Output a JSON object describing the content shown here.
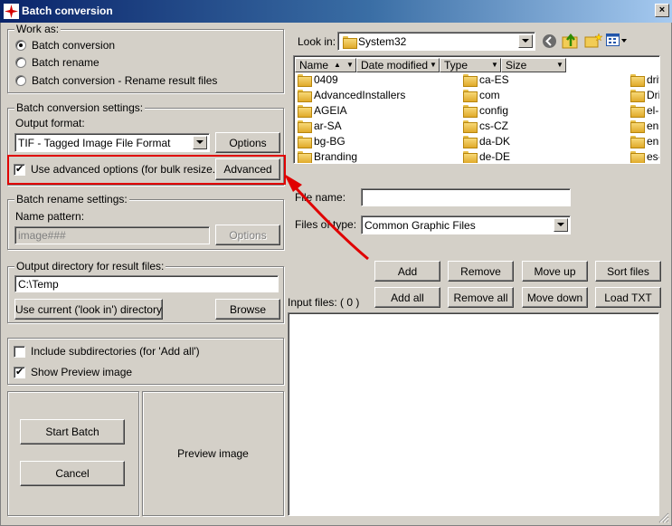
{
  "window": {
    "title": "Batch conversion",
    "close_glyph": "×"
  },
  "work_as": {
    "title": "Work as:",
    "options": [
      "Batch conversion",
      "Batch rename",
      "Batch conversion - Rename result files"
    ],
    "selected": 0
  },
  "conversion": {
    "title": "Batch conversion settings:",
    "output_format_label": "Output format:",
    "output_format_value": "TIF - Tagged Image File Format",
    "options_button": "Options",
    "advanced_checkbox": "Use advanced options (for bulk resize...)",
    "advanced_checked": true,
    "advanced_button": "Advanced"
  },
  "rename": {
    "title": "Batch rename settings:",
    "name_pattern_label": "Name pattern:",
    "name_pattern_value": "image###",
    "options_button": "Options"
  },
  "output_dir": {
    "title": "Output directory for result files:",
    "value": "C:\\Temp",
    "use_current_button": "Use current ('look in') directory",
    "browse_button": "Browse"
  },
  "flags": {
    "include_subdirs": "Include subdirectories (for 'Add all')",
    "include_subdirs_checked": false,
    "show_preview": "Show Preview image",
    "show_preview_checked": true
  },
  "actions": {
    "start": "Start Batch",
    "cancel": "Cancel"
  },
  "preview": {
    "label": "Preview image"
  },
  "browser": {
    "look_in_label": "Look in:",
    "look_in_value": "System32",
    "columns": [
      "Name",
      "Date modified",
      "Type",
      "Size"
    ],
    "files_col1": [
      "0409",
      "AdvancedInstallers",
      "AGEIA",
      "ar-SA",
      "bg-BG",
      "Branding"
    ],
    "files_col2": [
      "ca-ES",
      "com",
      "config",
      "cs-CZ",
      "da-DK",
      "de-DE"
    ],
    "files_col3": [
      "driv",
      "Driv",
      "el-G",
      "en",
      "en-U",
      "es-E"
    ],
    "file_name_label": "File name:",
    "file_name_value": "",
    "files_of_type_label": "Files of type:",
    "files_of_type_value": "Common Graphic Files"
  },
  "list_buttons": {
    "add": "Add",
    "remove": "Remove",
    "move_up": "Move up",
    "sort_files": "Sort files",
    "add_all": "Add all",
    "remove_all": "Remove all",
    "move_down": "Move down",
    "load_txt": "Load TXT"
  },
  "input_files_label": "Input files: ( 0 )",
  "annotation_color": "#e00000"
}
